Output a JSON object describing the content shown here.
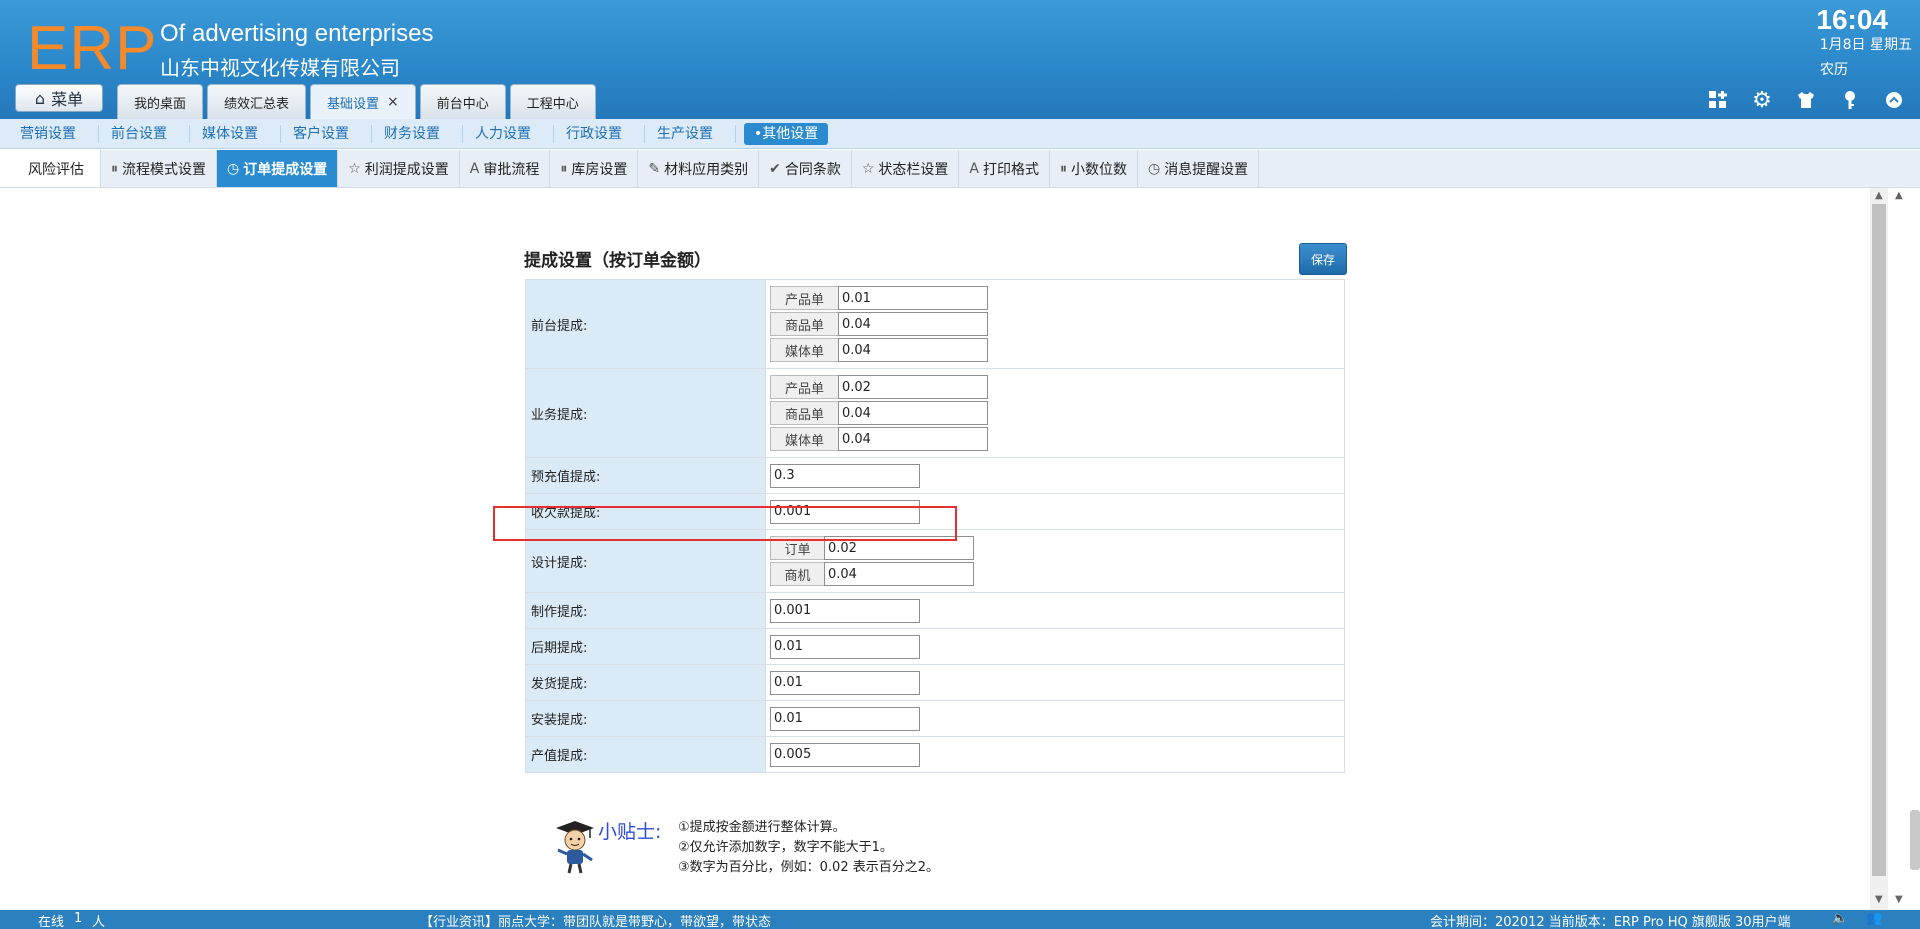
{
  "header": {
    "logo": "ERP",
    "company_en": "Of advertising enterprises",
    "company_cn": "山东中视文化传媒有限公司",
    "time": "16:04",
    "date": "1月8日 星期五",
    "lunar": "农历",
    "menu_label": "菜单",
    "tabs": [
      {
        "label": "我的桌面"
      },
      {
        "label": "绩效汇总表"
      },
      {
        "label": "基础设置",
        "close": "×"
      },
      {
        "label": "前台中心"
      },
      {
        "label": "工程中心"
      }
    ],
    "icons": [
      "grid-add-icon",
      "gear-icon",
      "shirt-icon",
      "key-icon",
      "collapse-up-icon"
    ]
  },
  "subnav": [
    "营销设置",
    "前台设置",
    "媒体设置",
    "客户设置",
    "财务设置",
    "人力设置",
    "行政设置",
    "生产设置",
    "•其他设置"
  ],
  "settings_tabs": [
    {
      "label": "风险评估",
      "icon": ""
    },
    {
      "label": "流程模式设置",
      "icon": "⏸"
    },
    {
      "label": "订单提成设置",
      "icon": "◷"
    },
    {
      "label": "利润提成设置",
      "icon": "☆"
    },
    {
      "label": "审批流程",
      "icon": "A"
    },
    {
      "label": "库房设置",
      "icon": "⏸"
    },
    {
      "label": "材料应用类别",
      "icon": "✎"
    },
    {
      "label": "合同条款",
      "icon": "✔"
    },
    {
      "label": "状态栏设置",
      "icon": "☆"
    },
    {
      "label": "打印格式",
      "icon": "A"
    },
    {
      "label": "小数位数",
      "icon": "⏸"
    },
    {
      "label": "消息提醒设置",
      "icon": "◷"
    }
  ],
  "form": {
    "title": "提成设置（按订单金额）",
    "save_label": "保存",
    "front": {
      "label": "前台提成:",
      "items": [
        {
          "name": "产品单",
          "value": "0.01"
        },
        {
          "name": "商品单",
          "value": "0.04"
        },
        {
          "name": "媒体单",
          "value": "0.04"
        }
      ]
    },
    "business": {
      "label": "业务提成:",
      "items": [
        {
          "name": "产品单",
          "value": "0.02"
        },
        {
          "name": "商品单",
          "value": "0.04"
        },
        {
          "name": "媒体单",
          "value": "0.04"
        }
      ]
    },
    "prepaid": {
      "label": "预充值提成:",
      "value": "0.3"
    },
    "arrears": {
      "label": "收欠款提成:",
      "value": "0.001"
    },
    "design": {
      "label": "设计提成:",
      "items": [
        {
          "name": "订单",
          "value": "0.02"
        },
        {
          "name": "商机",
          "value": "0.04"
        }
      ]
    },
    "production": {
      "label": "制作提成:",
      "value": "0.001"
    },
    "post": {
      "label": "后期提成:",
      "value": "0.01"
    },
    "shipping": {
      "label": "发货提成:",
      "value": "0.01"
    },
    "install": {
      "label": "安装提成:",
      "value": "0.01"
    },
    "output": {
      "label": "产值提成:",
      "value": "0.005"
    }
  },
  "tips": {
    "title": "小贴士:",
    "lines": [
      "①提成按金额进行整体计算。",
      "②仅允许添加数字，数字不能大于1。",
      "③数字为百分比，例如：0.02 表示百分之2。"
    ]
  },
  "status": {
    "online_label": "在线",
    "online_count": "1",
    "online_unit": "人",
    "news": "【行业资讯】丽点大学：带团队就是带野心，带欲望，带状态",
    "period": "会计期间：202012 当前版本：ERP Pro HQ 旗舰版 30用户端"
  }
}
